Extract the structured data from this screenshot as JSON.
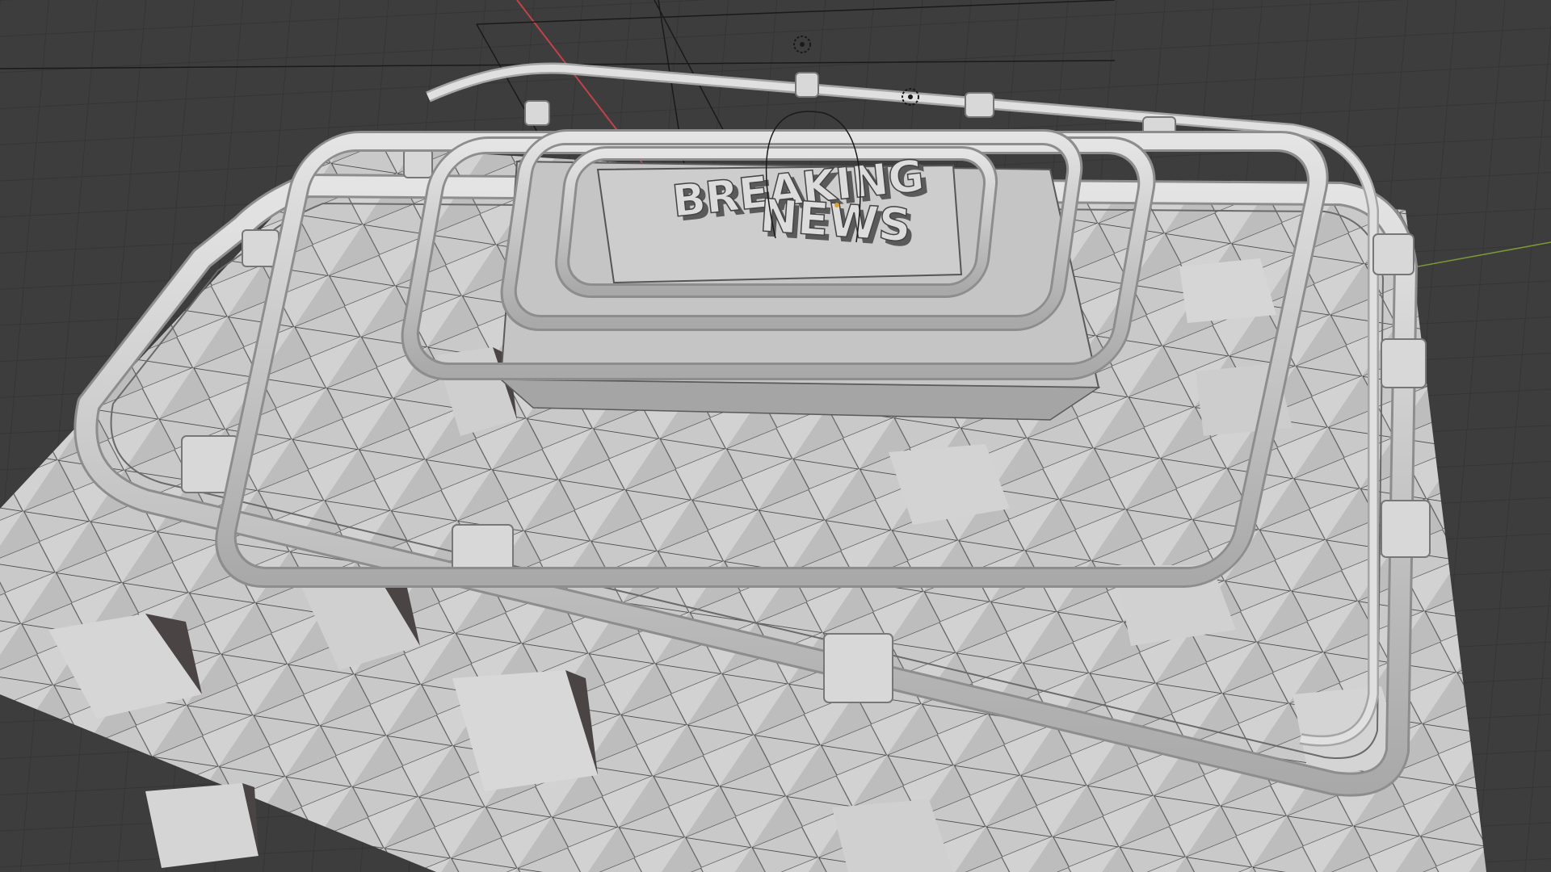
{
  "viewport": {
    "background_color": "#3d3d3d",
    "grid_line_color": "#2e2e2e",
    "x_axis_color": "#c0424a",
    "y_axis_color": "#7a9a35",
    "model_color": "#c6c6c6",
    "shadow_color": "#4a4445"
  },
  "logo": {
    "line1": "BREAKING",
    "line2": "NEWS"
  },
  "scene_objects": {
    "camera_icon": "camera-icon",
    "light_icon": "light-icon"
  }
}
